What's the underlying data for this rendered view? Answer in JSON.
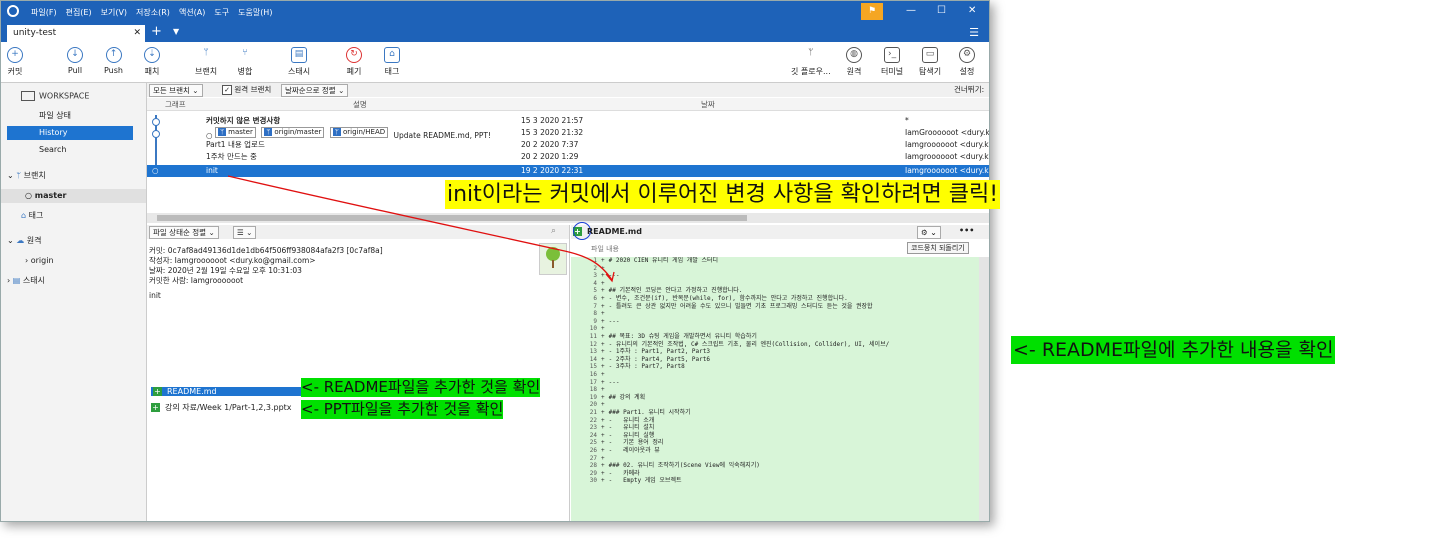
{
  "window": {
    "menu": [
      "파일(F)",
      "편집(E)",
      "보기(V)",
      "저장소(R)",
      "액션(A)",
      "도구",
      "도움말(H)"
    ],
    "tab_title": "unity-test"
  },
  "toolbar": {
    "left": [
      {
        "label": "커밋",
        "icon": "commit-icon"
      },
      {
        "label": "Pull",
        "icon": "pull-icon"
      },
      {
        "label": "Push",
        "icon": "push-icon"
      },
      {
        "label": "패치",
        "icon": "fetch-icon"
      },
      {
        "label": "브랜치",
        "icon": "branch-icon"
      },
      {
        "label": "병합",
        "icon": "merge-icon"
      },
      {
        "label": "스태시",
        "icon": "stash-icon"
      },
      {
        "label": "폐기",
        "icon": "discard-icon"
      },
      {
        "label": "태그",
        "icon": "tag-icon"
      }
    ],
    "right": [
      {
        "label": "깃 플로우...",
        "icon": "gitflow-icon"
      },
      {
        "label": "원격",
        "icon": "remote-icon"
      },
      {
        "label": "터미널",
        "icon": "terminal-icon"
      },
      {
        "label": "탐색기",
        "icon": "explorer-icon"
      },
      {
        "label": "설정",
        "icon": "settings-icon"
      }
    ]
  },
  "sidebar": {
    "workspace": "WORKSPACE",
    "items": [
      "파일 상태",
      "History",
      "Search"
    ],
    "branches_label": "브랜치",
    "branch": "master",
    "tags_label": "태그",
    "remotes_label": "원격",
    "remote": "origin",
    "stash_label": "스태시"
  },
  "filters": {
    "all_branches": "모든 브랜치",
    "remote_branches": "원격 브랜치",
    "sort": "날짜순으로 정렬",
    "jump": "건너뛰기:"
  },
  "columns": [
    "그래프",
    "설명",
    "날짜"
  ],
  "commits": [
    {
      "desc": "커밋하지 않은 변경사항",
      "date": "15 3 2020 21:57",
      "author": "*"
    },
    {
      "desc": "Update README.md, PPT!",
      "date": "15 3 2020 21:32",
      "author": "IamGroooooot <dury.k",
      "badges": [
        "master",
        "origin/master",
        "origin/HEAD"
      ]
    },
    {
      "desc": "Part1 내용 업로드",
      "date": "20 2 2020 7:37",
      "author": "Iamgroooooot <dury.k"
    },
    {
      "desc": "1주차 만드는 중",
      "date": "20 2 2020 1:29",
      "author": "Iamgroooooot <dury.k"
    },
    {
      "desc": "init",
      "date": "19 2 2020 22:31",
      "author": "Iamgroooooot <dury.k"
    }
  ],
  "details": {
    "sort": "파일 상태순 정렬",
    "view": "☰",
    "commit": "커밋: 0c7af8ad49136d1de1db64f506ff938084afa2f3 [0c7af8a]",
    "author": "작성자: Iamgroooooot <dury.ko@gmail.com>",
    "date": "날짜: 2020년 2월 19일 수요일 오후 10:31:03",
    "committer": "커밋한 사람: Iamgroooooot",
    "message": "init",
    "files": [
      "README.md",
      "강의 자료/Week 1/Part-1,2,3.pptx"
    ]
  },
  "diff": {
    "file": "README.md",
    "chunk": "파일 내용",
    "revert": "코드뭉치 되돌리기",
    "lines": [
      "# 2020 CIEN 유니티 게임 개발 스터디",
      "",
      "---",
      "",
      "## 기본적인 코딩은 안다고 가정하고 진행합니다.",
      "- 변수, 조건문(if), 반복문(while, for), 함수까지는 안다고 가정하고 진행합니다.",
      "- 틀려도 큰 상관 없지만 어려울 수도 있으니 빌들면 기초 프로그래밍 스터디도 듣는 것을 권장합",
      "",
      "---",
      "",
      "## 목표: 3D 슈팅 게임을 개발하면서 유니티 학습하기",
      "- 유니티의 기본적인 조작법, C# 스크립트 기초, 물리 엔진(Collision, Collider), UI, 세이브/",
      "- 1주차 : Part1, Part2, Part3",
      "- 2주차 : Part4, Part5, Part6",
      "- 3주차 : Part7, Part8",
      "",
      "---",
      "",
      "## 강의 계획",
      "",
      "### Part1. 유니티 시작하기",
      "-   유니티 소개",
      "-   유니티 설치",
      "-   유니티 실행",
      "-   기본 용어 정리",
      "-   레이아웃과 뷰",
      "",
      "### 02. 유니티 조작하기(Scene View에 익숙해지기)",
      "-   카메라",
      "-   Empty 게임 오브젝트"
    ]
  },
  "annotations": {
    "click_hint": "init이라는 커밋에서 이루어진 변경 사항을 확인하려면 클릭!",
    "readme_added": "<- README파일을 추가한 것을 확인",
    "ppt_added": "<- PPT파일을 추가한 것을 확인",
    "readme_content": "<- README파일에 추가한 내용을 확인"
  },
  "colors": {
    "accent": "#1e62b8",
    "selection": "#1e74d0",
    "annotation_green": "#00e000",
    "annotation_yellow": "#ffff00",
    "diff_added": "#d8f5d8"
  }
}
